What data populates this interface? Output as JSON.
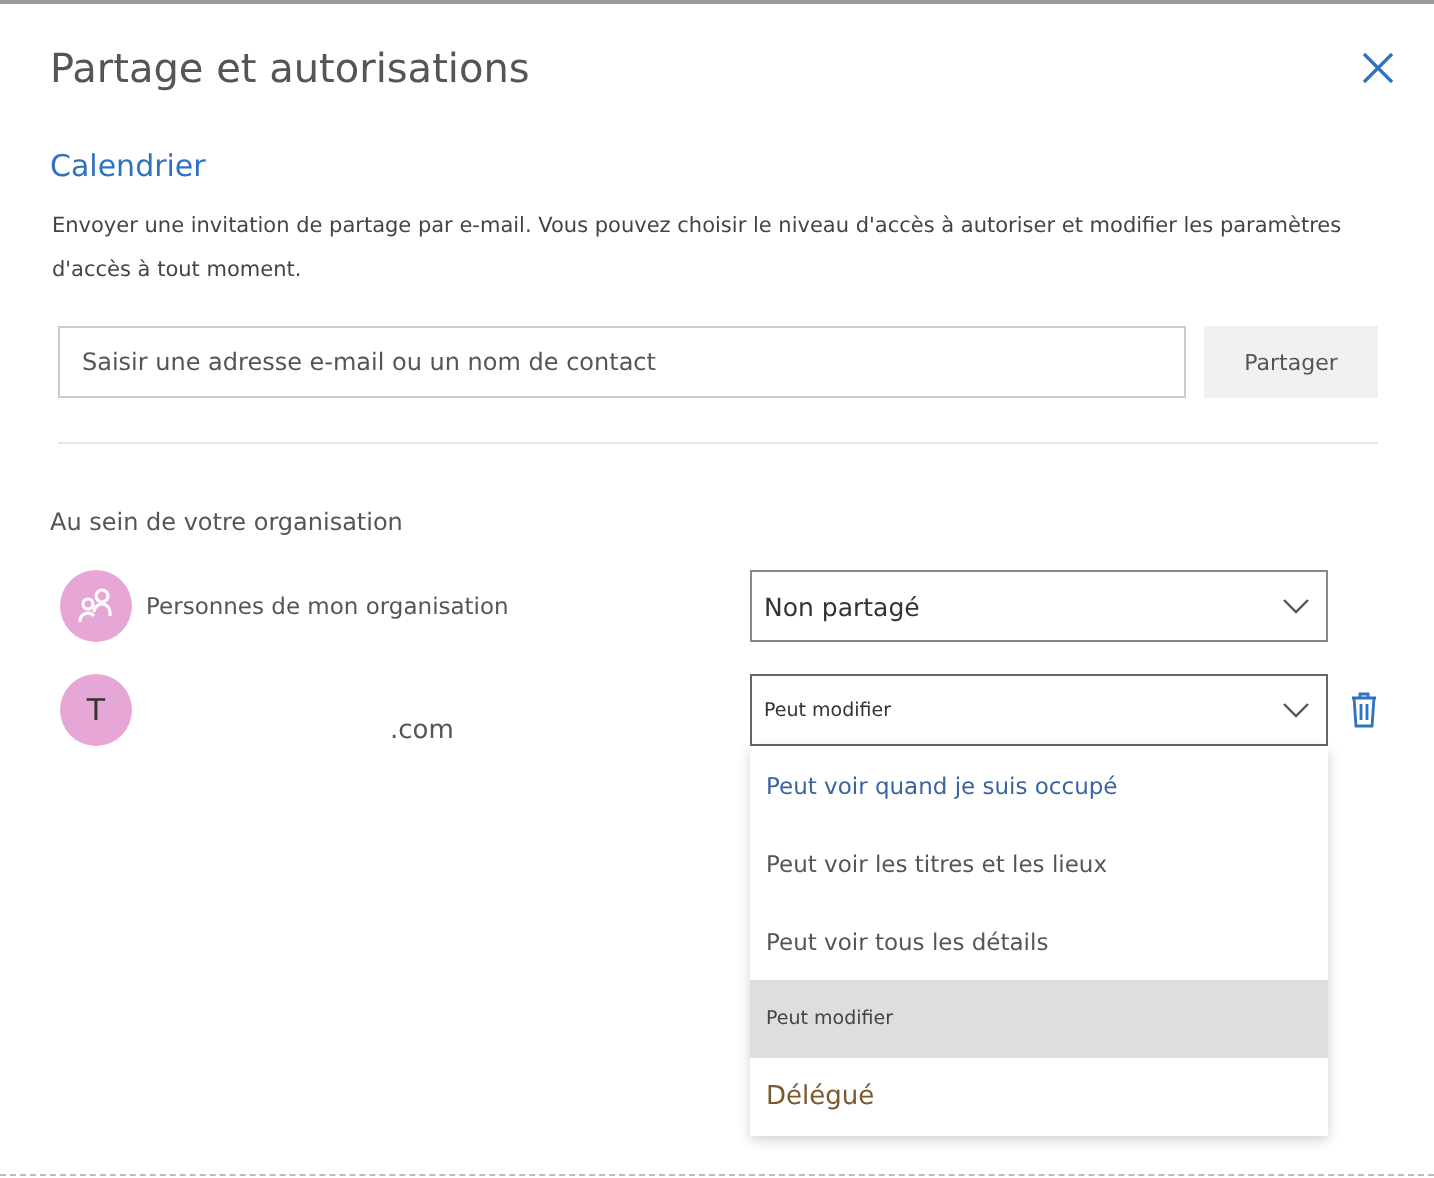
{
  "dialog": {
    "title": "Partage et autorisations",
    "calendar_name": "Calendrier",
    "description": "Envoyer une invitation de partage par e-mail. Vous pouvez choisir le niveau d'accès à autoriser et modifier les paramètres d'accès à tout moment.",
    "invite": {
      "placeholder": "Saisir une adresse e-mail ou un nom de contact",
      "button": "Partager"
    }
  },
  "organisation": {
    "heading": "Au sein de votre organisation",
    "members": [
      {
        "kind": "group",
        "name": "Personnes de mon organisation",
        "permission": "Non partagé",
        "expanded": false
      },
      {
        "kind": "person",
        "initial": "T",
        "name": ".com",
        "permission": "Peut modifier",
        "expanded": true,
        "removable": true
      }
    ]
  },
  "permission_menu": [
    {
      "label": "Peut voir quand je suis occupé",
      "selected": false
    },
    {
      "label": "Peut voir les titres et les lieux",
      "selected": false
    },
    {
      "label": "Peut voir tous les détails",
      "selected": false
    },
    {
      "label": "Peut modifier",
      "selected": true
    },
    {
      "label": "Délégué",
      "selected": false
    }
  ]
}
